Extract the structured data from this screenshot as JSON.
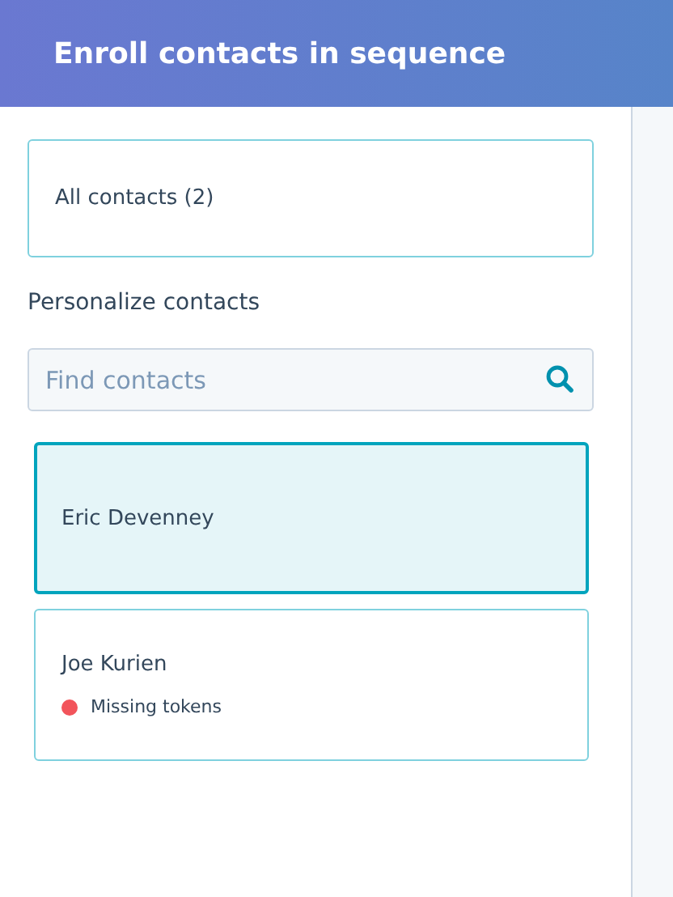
{
  "header": {
    "title": "Enroll contacts in sequence"
  },
  "all_contacts": {
    "label": "All contacts (2)"
  },
  "section_label": "Personalize contacts",
  "search": {
    "placeholder": "Find contacts"
  },
  "contacts": [
    {
      "name": "Eric Devenney",
      "selected": true
    },
    {
      "name": "Joe Kurien",
      "selected": false,
      "status": {
        "text": "Missing tokens",
        "color": "#f2545b"
      }
    }
  ]
}
